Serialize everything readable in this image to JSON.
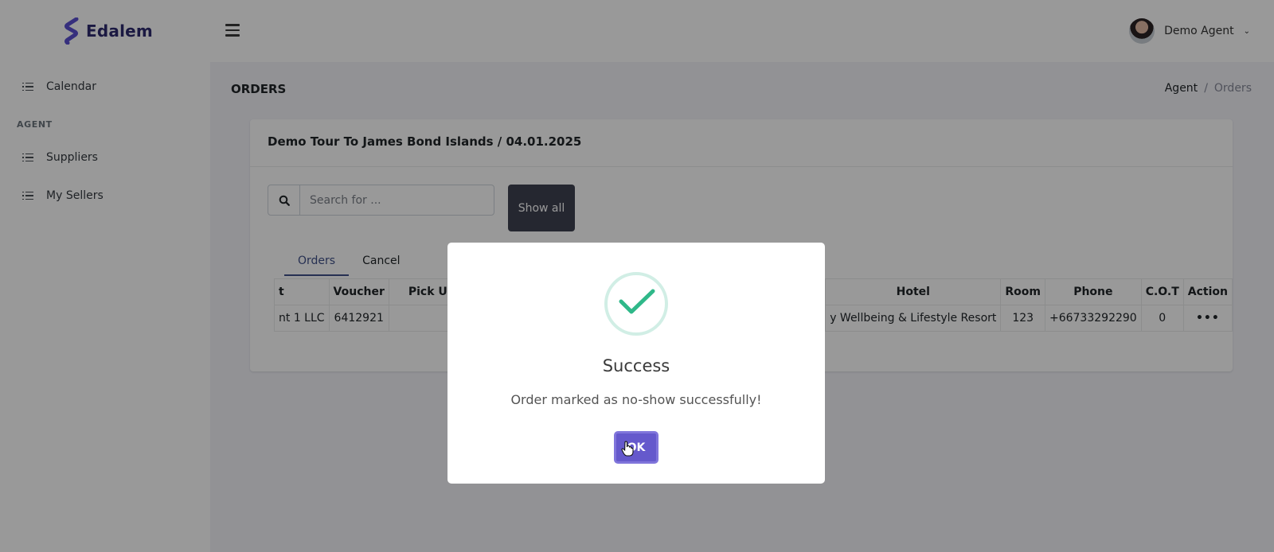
{
  "app": {
    "logo_text": "Edalem",
    "user_name": "Demo Agent"
  },
  "sidebar": {
    "items": [
      {
        "label": "Calendar"
      },
      {
        "label": "Suppliers"
      },
      {
        "label": "My Sellers"
      }
    ],
    "section_heading": "AGENT"
  },
  "page": {
    "title": "ORDERS",
    "breadcrumb": {
      "root": "Agent",
      "separator": "/",
      "current": "Orders"
    }
  },
  "card": {
    "title": "Demo Tour To James Bond Islands / 04.01.2025",
    "search_placeholder": "Search for ...",
    "show_all_label": "Show all",
    "tabs": [
      {
        "label": "Orders",
        "active": true
      },
      {
        "label": "Cancel",
        "active": false
      }
    ],
    "table": {
      "columns": [
        "t",
        "Voucher",
        "Pick Up",
        "Hotel",
        "Room",
        "Phone",
        "C.O.T",
        "Action"
      ],
      "rows": [
        {
          "agent": "nt 1 LLC",
          "voucher": "6412921",
          "pickup": "",
          "hotel": "y Wellbeing & Lifestyle Resort",
          "room": "123",
          "phone": "+66733292290",
          "cot": "0",
          "action": "•••"
        }
      ]
    }
  },
  "modal": {
    "title": "Success",
    "message": "Order marked as no-show successfully!",
    "ok_label": "OK"
  },
  "colors": {
    "primary": "#405189",
    "success": "#1aab7e",
    "ok_button": "#6559cc",
    "dark_button": "#3f4151"
  }
}
